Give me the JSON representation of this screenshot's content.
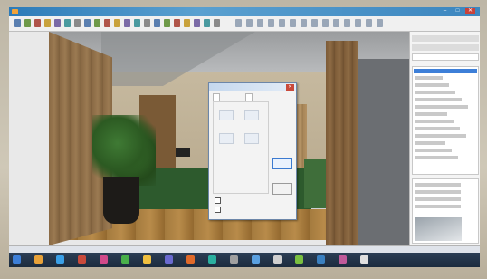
{
  "window": {
    "title": "",
    "min_label": "–",
    "max_label": "□",
    "close_label": "✕"
  },
  "toolbar": {
    "icons": [
      "new-icon",
      "open-icon",
      "save-icon",
      "print-icon",
      "undo-icon",
      "redo-icon",
      "cut-icon",
      "copy-icon",
      "paste-icon",
      "select-icon",
      "pan-icon",
      "zoom-icon",
      "rotate-icon",
      "wall-icon",
      "door-icon",
      "window-icon",
      "stair-icon",
      "roof-icon",
      "camera-icon",
      "render-icon",
      "help-icon"
    ]
  },
  "dialog": {
    "title": "",
    "close_label": "✕",
    "tabs": [
      "",
      ""
    ],
    "ok_label": "",
    "cancel_label": "",
    "checks": [
      "",
      ""
    ]
  },
  "right_panel": {
    "header_1": "",
    "header_2": ""
  },
  "status": {
    "text": ""
  },
  "taskbar": {
    "time": "",
    "date": ""
  },
  "colors": {
    "titlebar": "#2d7bb8",
    "selection": "#3d7fd8",
    "taskbar": "#1c2b3e"
  }
}
